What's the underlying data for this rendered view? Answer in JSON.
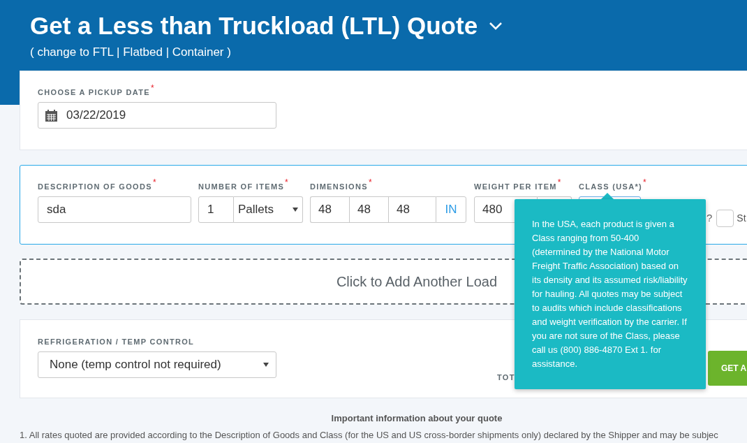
{
  "header": {
    "title": "Get a Less than Truckload (LTL) Quote",
    "subtitle": "( change to FTL | Flatbed | Container )"
  },
  "pickup": {
    "label": "CHOOSE A PICKUP DATE",
    "required_mark": "*",
    "value": "03/22/2019"
  },
  "load": {
    "description": {
      "label": "DESCRIPTION OF GOODS",
      "required_mark": "*",
      "value": "sda"
    },
    "items": {
      "label": "NUMBER OF ITEMS",
      "required_mark": "*",
      "count": "1",
      "unit": "Pallets"
    },
    "dimensions": {
      "label": "DIMENSIONS",
      "required_mark": "*",
      "values": [
        "48",
        "48",
        "48"
      ],
      "unit": "IN"
    },
    "weight": {
      "label": "WEIGHT PER ITEM",
      "required_mark": "*",
      "value": "480"
    },
    "class": {
      "label": "CLASS (USA*)",
      "required_mark": "*"
    },
    "question_mark": "?",
    "checkbox": {
      "label": "St",
      "checked": false
    }
  },
  "add_load": "Click to Add Another Load",
  "refrigeration": {
    "label": "REFRIGERATION / TEMP CONTROL"
  },
  "refrigeration_value": "None (temp control not required)",
  "total_label": "TOT",
  "get_button": "GET A",
  "tooltip": "In the USA, each product is given a Class ranging from 50-400 (determined by the National Motor Freight Traffic Association) based on its density and its assumed risk/liability for hauling. All quotes may be subject to audits which include classifications and weight verification by the carrier. If you are not sure of the Class, please call us (800) 886-4870 Ext 1. for assistance.",
  "info": {
    "title": "Important information about your quote",
    "note": "1. All rates quoted are provided according to the Description of Goods and Class (for the US and US cross-border shipments only) declared by the Shipper and may be subjec"
  }
}
